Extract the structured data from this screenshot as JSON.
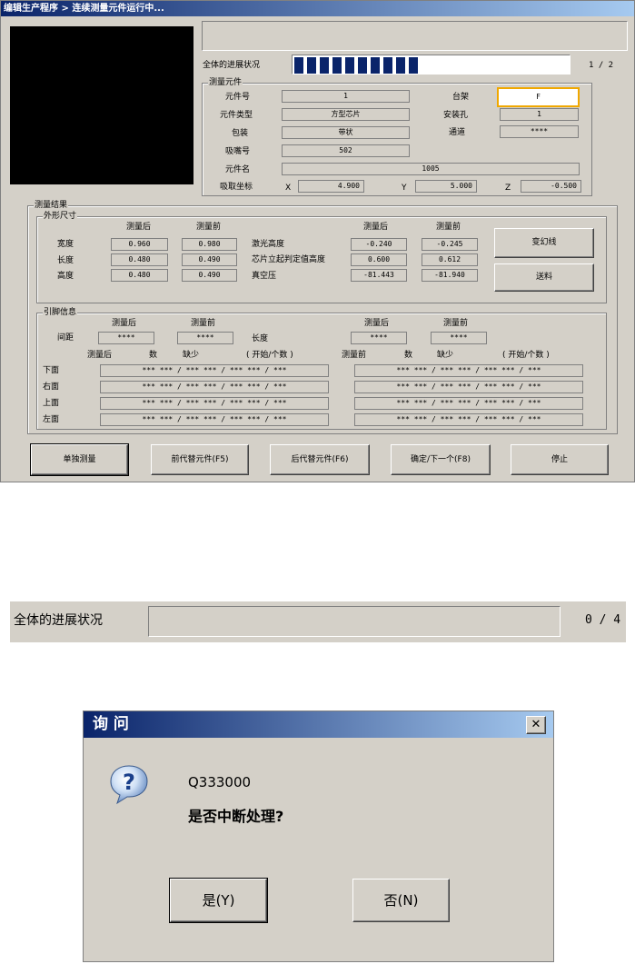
{
  "window": {
    "title": "编辑生产程序 > 连续测量元件运行中..."
  },
  "progress": {
    "label": "全体的进展状况",
    "counter": "1 / 2",
    "filled_blocks": 10,
    "total_blocks": 10
  },
  "component": {
    "group_title": "测量元件",
    "part_no_label": "元件号",
    "part_no": "1",
    "type_label": "元件类型",
    "type": "方型芯片",
    "package_label": "包装",
    "package": "带状",
    "nozzle_label": "吸嘴号",
    "nozzle": "502",
    "name_label": "元件名",
    "name": "1005",
    "pick_label": "吸取坐标",
    "x_label": "X",
    "x": "4.900",
    "y_label": "Y",
    "y": "5.000",
    "z_label": "Z",
    "z": "-0.500",
    "rack_label": "台架",
    "rack": "F",
    "hole_label": "安装孔",
    "hole": "1",
    "channel_label": "通道",
    "channel": "****"
  },
  "results": {
    "group_title": "测量结果",
    "shape": {
      "title": "外形尺寸",
      "after": "测量后",
      "before": "测量前",
      "rows": [
        {
          "label": "宽度",
          "after": "0.960",
          "before": "0.980"
        },
        {
          "label": "长度",
          "after": "0.480",
          "before": "0.490"
        },
        {
          "label": "高度",
          "after": "0.480",
          "before": "0.490"
        }
      ],
      "right_rows": [
        {
          "label": "激光高度",
          "after": "-0.240",
          "before": "-0.245"
        },
        {
          "label": "芯片立起判定值高度",
          "after": "0.600",
          "before": "0.612"
        },
        {
          "label": "真空压",
          "after": "-81.443",
          "before": "-81.940"
        }
      ],
      "btn_change_line": "变幻线",
      "btn_feed": "送料"
    },
    "leads": {
      "title": "引脚信息",
      "after": "测量后",
      "before": "测量前",
      "pitch_label": "间距",
      "pitch_after": "****",
      "pitch_before": "****",
      "length_label": "长度",
      "length_after": "****",
      "length_before": "****",
      "col_after": "测量后",
      "col_before": "测量前",
      "col_count": "数",
      "col_missing": "缺少",
      "col_range": "( 开始/个数 )",
      "rows": [
        {
          "label": "下面",
          "left": "*** *** / *** *** / *** *** / ***",
          "right": "*** *** / *** *** / *** *** / ***"
        },
        {
          "label": "右面",
          "left": "*** *** / *** *** / *** *** / ***",
          "right": "*** *** / *** *** / *** *** / ***"
        },
        {
          "label": "上面",
          "left": "*** *** / *** *** / *** *** / ***",
          "right": "*** *** / *** *** / *** *** / ***"
        },
        {
          "label": "左面",
          "left": "*** *** / *** *** / *** *** / ***",
          "right": "*** *** / *** *** / *** *** / ***"
        }
      ]
    }
  },
  "buttons": {
    "single": "单独测量",
    "prev_alt": "前代替元件(F5)",
    "next_alt": "后代替元件(F6)",
    "confirm_next": "确定/下一个(F8)",
    "stop": "停止"
  },
  "progress2": {
    "label": "全体的进展状况",
    "counter": "0 / 4"
  },
  "dialog": {
    "title": "询 问",
    "close": "✕",
    "code": "Q333000",
    "message": "是否中断处理?",
    "yes": "是(Y)",
    "no": "否(N)"
  },
  "colors": {
    "accent": "#0a246a",
    "highlight": "#f0a800"
  }
}
